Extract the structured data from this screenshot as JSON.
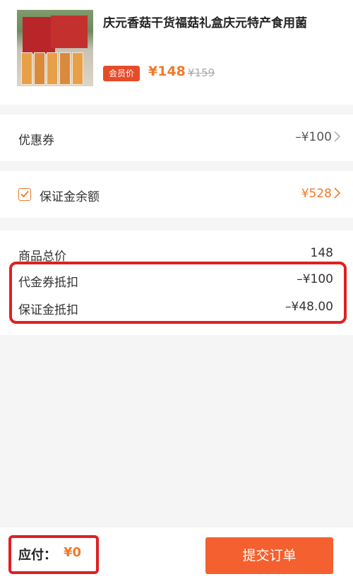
{
  "product": {
    "title": "庆元香菇干货福菇礼盒庆元特产食用菌",
    "member_badge": "会员价",
    "price": "¥148",
    "original_price": "¥159"
  },
  "coupon": {
    "label": "优惠券",
    "value": "–¥100"
  },
  "deposit": {
    "label": "保证金余额",
    "value": "¥528",
    "checked": true
  },
  "summary": {
    "total_label": "商品总价",
    "total_value": "148",
    "voucher_label": "代金券抵扣",
    "voucher_value": "–¥100",
    "deposit_deduct_label": "保证金抵扣",
    "deposit_deduct_value": "–¥48.00"
  },
  "footer": {
    "pay_label": "应付：",
    "pay_amount": "¥0",
    "submit_label": "提交订单"
  },
  "colors": {
    "accent": "#f07a2a",
    "button": "#f4602f",
    "highlight": "#e02020"
  }
}
